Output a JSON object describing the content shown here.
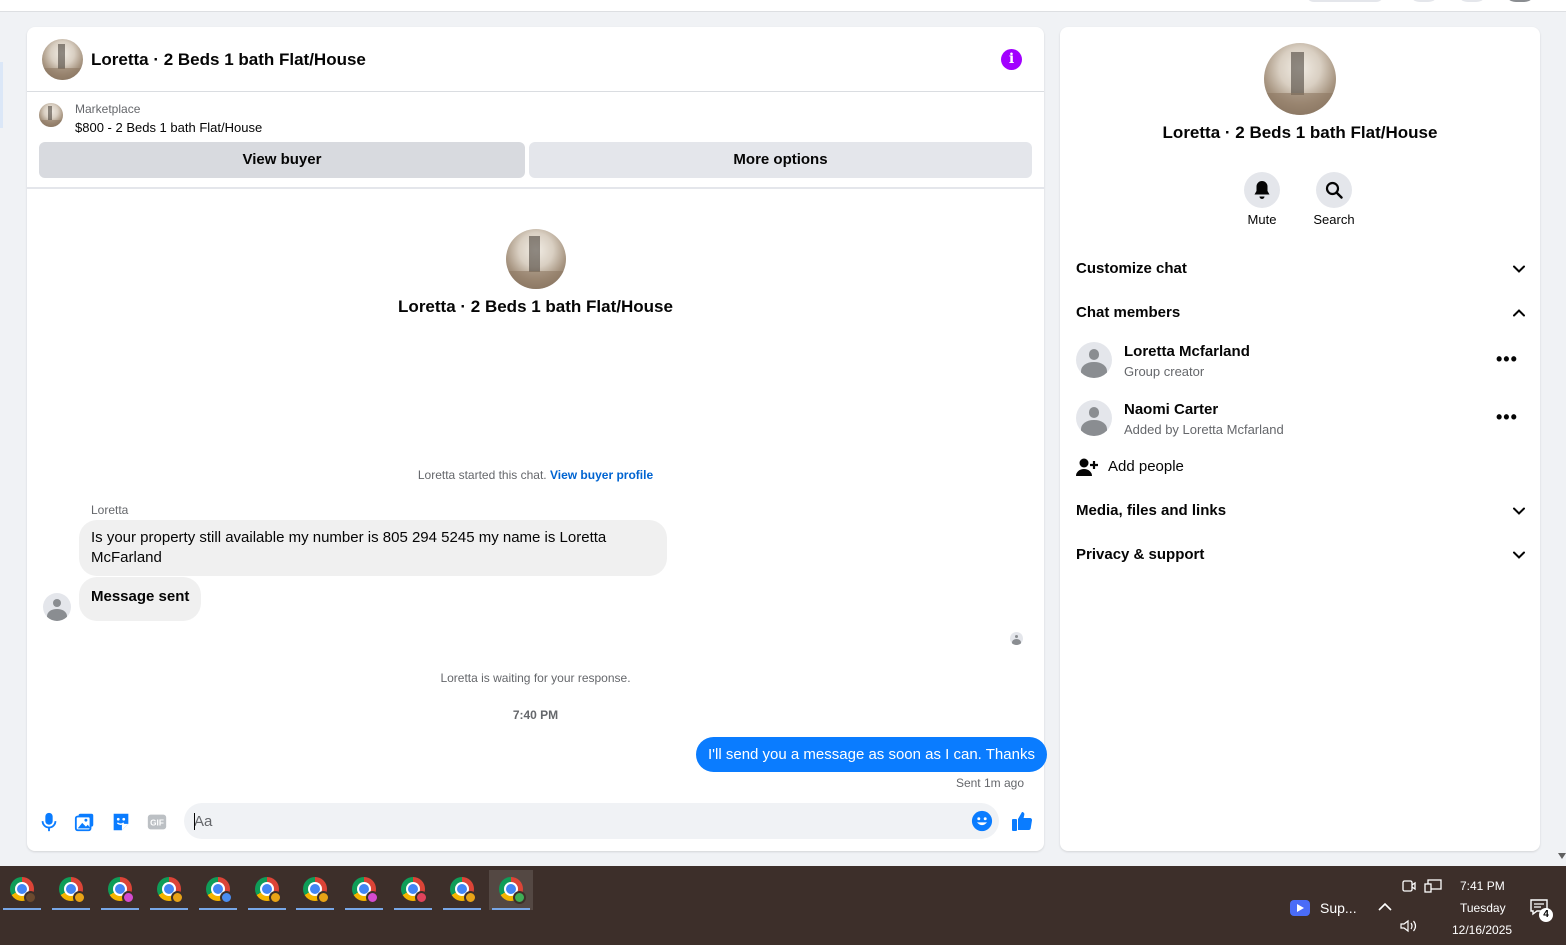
{
  "conversation": {
    "title": "Loretta · 2 Beds 1 bath Flat/House",
    "marketplace_label": "Marketplace",
    "listing": "$800 - 2 Beds 1 bath Flat/House",
    "view_buyer_label": "View buyer",
    "more_options_label": "More options",
    "info_glyph": "i",
    "center_title": "Loretta · 2 Beds 1 bath Flat/House",
    "started_text": "Loretta started this chat.",
    "view_profile_link": "View buyer profile",
    "messages": [
      {
        "sender": "Loretta",
        "text": "Is your property still available my number is 805 294 5245 my name is Loretta McFarland"
      },
      {
        "text": "Message sent"
      }
    ],
    "waiting_text": "Loretta is waiting for your response.",
    "timestamp": "7:40 PM",
    "outgoing_message": "I'll send you a message as soon as I can. Thanks",
    "sent_status": "Sent 1m ago",
    "composer_placeholder": "Aa"
  },
  "details": {
    "title": "Loretta · 2 Beds 1 bath Flat/House",
    "mute_label": "Mute",
    "search_label": "Search",
    "sections": {
      "customize": "Customize chat",
      "members": "Chat members",
      "media": "Media, files and links",
      "privacy": "Privacy & support"
    },
    "members": [
      {
        "name": "Loretta Mcfarland",
        "role": "Group creator"
      },
      {
        "name": "Naomi Carter",
        "role": "Added by Loretta Mcfarland"
      }
    ],
    "add_people_label": "Add people",
    "more_glyph": "•••"
  },
  "taskbar": {
    "app_count": 12,
    "profile_colors": [
      "#e8a317",
      "#e8a317",
      "#d44bd0",
      "#e8a317",
      "#4a8df0",
      "#e8a317",
      "#e8a317",
      "#d44bd0",
      "#e0435c",
      "#e8a317",
      "#3fae56"
    ],
    "zoom_label": "Sup...",
    "time": "7:41 PM",
    "day": "Tuesday",
    "date": "12/16/2025",
    "notification_count": "4"
  },
  "colors": {
    "accent_blue": "#0a7cff",
    "link_blue": "#0064d1",
    "info_purple": "#a200ff",
    "taskbar": "#3d2f2a"
  }
}
